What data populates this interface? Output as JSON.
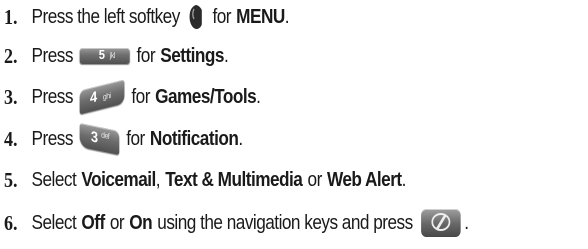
{
  "steps": [
    {
      "num": "1.",
      "pre": "Press the left softkey",
      "icon": "left-softkey-icon",
      "mid": "for",
      "bold": "MENU",
      "post": "."
    },
    {
      "num": "2.",
      "pre": "Press",
      "key_digit": "5",
      "key_letters": "jkl",
      "mid": "for",
      "bold": "Settings",
      "post": "."
    },
    {
      "num": "3.",
      "pre": "Press",
      "key_digit": "4",
      "key_letters": "ghi",
      "mid": "for",
      "bold": "Games/Tools",
      "post": "."
    },
    {
      "num": "4.",
      "pre": "Press",
      "key_digit": "3",
      "key_letters": "def",
      "mid": "for",
      "bold": "Notification",
      "post": "."
    },
    {
      "num": "5.",
      "pre": "Select",
      "bold1": "Voicemail",
      "sep1": ",",
      "bold2": "Text & Multimedia",
      "sep2": "or",
      "bold3": "Web Alert",
      "post": "."
    },
    {
      "num": "6.",
      "pre": "Select",
      "bold1": "Off",
      "sep1": "or",
      "bold2": "On",
      "mid": "using the navigation keys and press",
      "icon": "ok-key-icon",
      "post": "."
    }
  ],
  "colors": {
    "text": "#1a1a1a",
    "key": "#6e6e6e"
  }
}
